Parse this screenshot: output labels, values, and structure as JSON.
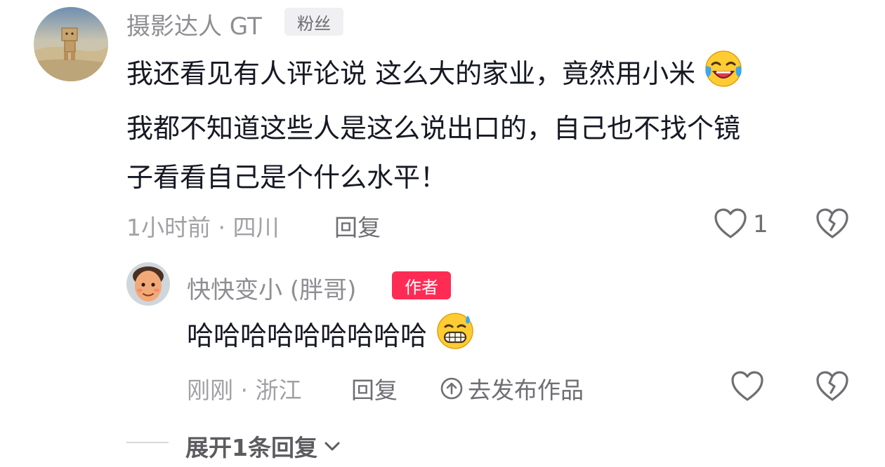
{
  "comment": {
    "username": "摄影达人 GT",
    "badge": "粉丝",
    "text_line1": "我还看见有人评论说 这么大的家业，竟然用小米",
    "text_line2": "我都不知道这些人是这么说出口的，自己也不找个镜",
    "text_line3": "子看看自己是个什么水平！",
    "time_location": "1小时前 · 四川",
    "reply_label": "回复",
    "like_count": "1",
    "emoji_icon": "laughing-crying-emoji-icon"
  },
  "reply": {
    "username": "快快变小 (胖哥)",
    "badge": "作者",
    "text": "哈哈哈哈哈哈哈哈哈",
    "time_location": "刚刚 · 浙江",
    "reply_label": "回复",
    "publish_label": "去发布作品",
    "emoji_icon": "grinning-sweat-emoji-icon"
  },
  "expand_label": "展开1条回复",
  "watermark": "",
  "colors": {
    "author_badge": "#fe2c55",
    "text": "#161823",
    "meta": "#a1a1a6"
  }
}
